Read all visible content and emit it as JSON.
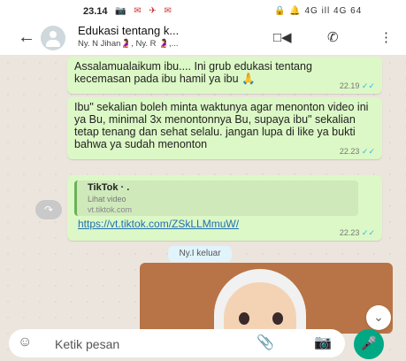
{
  "status_bar": {
    "time": "23.14",
    "left_icons": "📷 ✉ ✈ ✉",
    "right_icons": "🔒 🔔 4G ill 4G 64"
  },
  "header": {
    "back_icon": "←",
    "title": "Edukasi tentang k...",
    "subtitle": "Ny. N Jihan🤰, Ny. R 🤰,...",
    "video_icon": "□◀",
    "call_icon": "✆",
    "more_icon": "⋮"
  },
  "messages": [
    {
      "text": "Assalamualaikum ibu.... Ini grub edukasi tentang kecemasan pada ibu hamil ya ibu 🙏",
      "time": "22.19"
    },
    {
      "text": "Ibu\" sekalian boleh minta waktunya agar menonton video ini ya Bu, minimal 3x menontonnya Bu, supaya ibu\" sekalian tetap tenang dan sehat selalu. jangan lupa di like ya bukti bahwa ya sudah menonton",
      "time": "22.23"
    },
    {
      "preview_title": "TikTok · .",
      "preview_desc": "Lihat video",
      "preview_domain": "vt.tiktok.com",
      "link": "https://vt.tiktok.com/ZSkLLMmuW/",
      "time": "22.23"
    }
  ],
  "system_message": "Ny.I keluar",
  "composer": {
    "placeholder": "Ketik pesan",
    "emoji_icon": "☺",
    "attach_icon": "📎",
    "camera_icon": "📷",
    "mic_icon": "🎤"
  },
  "scroll_icon": "⌄",
  "forward_icon": "↷",
  "colors": {
    "accent": "#00a884",
    "bubble": "#dcf8c6",
    "wall": "#ece5dd",
    "link": "#1f6fb2"
  }
}
